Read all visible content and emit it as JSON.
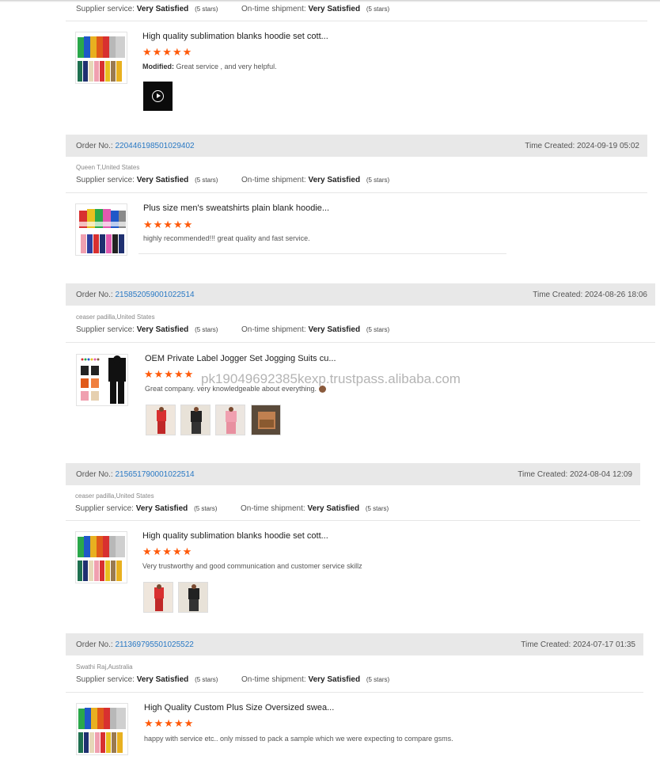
{
  "labels": {
    "order_no": "Order No.:",
    "time_created": "Time Created:",
    "supplier_service": "Supplier service:",
    "ontime_shipment": "On-time shipment:",
    "modified": "Modified:"
  },
  "top": {
    "supplier_value": "Very Satisfied",
    "supplier_stars": "(5 stars)",
    "shipment_value": "Very Satisfied",
    "shipment_stars": "(5 stars)",
    "product_title": "High quality sublimation blanks hoodie set cott...",
    "stars": "★★★★★",
    "review": "Great service , and very helpful.",
    "video_icon": "play-icon"
  },
  "orders": [
    {
      "order_no": "220446198501029402",
      "time": "2024-09-19 05:02",
      "buyer": "Queen T,United States",
      "supplier_value": "Very Satisfied",
      "supplier_stars": "(5 stars)",
      "shipment_value": "Very Satisfied",
      "shipment_stars": "(5 stars)",
      "product_title": "Plus size men's sweatshirts plain blank hoodie...",
      "stars": "★★★★★",
      "review": "highly recommended!!! great quality and fast service."
    },
    {
      "order_no": "215852059001022514",
      "time": "2024-08-26 18:06",
      "buyer": "ceaser padilla,United States",
      "supplier_value": "Very Satisfied",
      "supplier_stars": "(5 stars)",
      "shipment_value": "Very Satisfied",
      "shipment_stars": "(5 stars)",
      "product_title": "OEM Private Label Jogger Set Jogging Suits cu...",
      "stars": "★★★★★",
      "review": "Great company. very knowledgeable about everything."
    },
    {
      "order_no": "215651790001022514",
      "time": "2024-08-04 12:09",
      "buyer": "ceaser padilla,United States",
      "supplier_value": "Very Satisfied",
      "supplier_stars": "(5 stars)",
      "shipment_value": "Very Satisfied",
      "shipment_stars": "(5 stars)",
      "product_title": "High quality sublimation blanks hoodie set cott...",
      "stars": "★★★★★",
      "review": "Very trustworthy and good communication and customer service skillz"
    },
    {
      "order_no": "211369795501025522",
      "time": "2024-07-17 01:35",
      "buyer": "Swathi Raj,Australia",
      "supplier_value": "Very Satisfied",
      "supplier_stars": "(5 stars)",
      "shipment_value": "Very Satisfied",
      "shipment_stars": "(5 stars)",
      "product_title": "High Quality Custom Plus Size Oversized swea...",
      "stars": "★★★★★",
      "review": "happy with service etc.. only missed to pack a sample which we were expecting to compare gsms."
    }
  ],
  "watermark": "pk19049692385kexp.trustpass.alibaba.com",
  "colors": {
    "link": "#2a79c4",
    "star": "#ff5a0a",
    "header_bg": "#e8e8e8"
  }
}
